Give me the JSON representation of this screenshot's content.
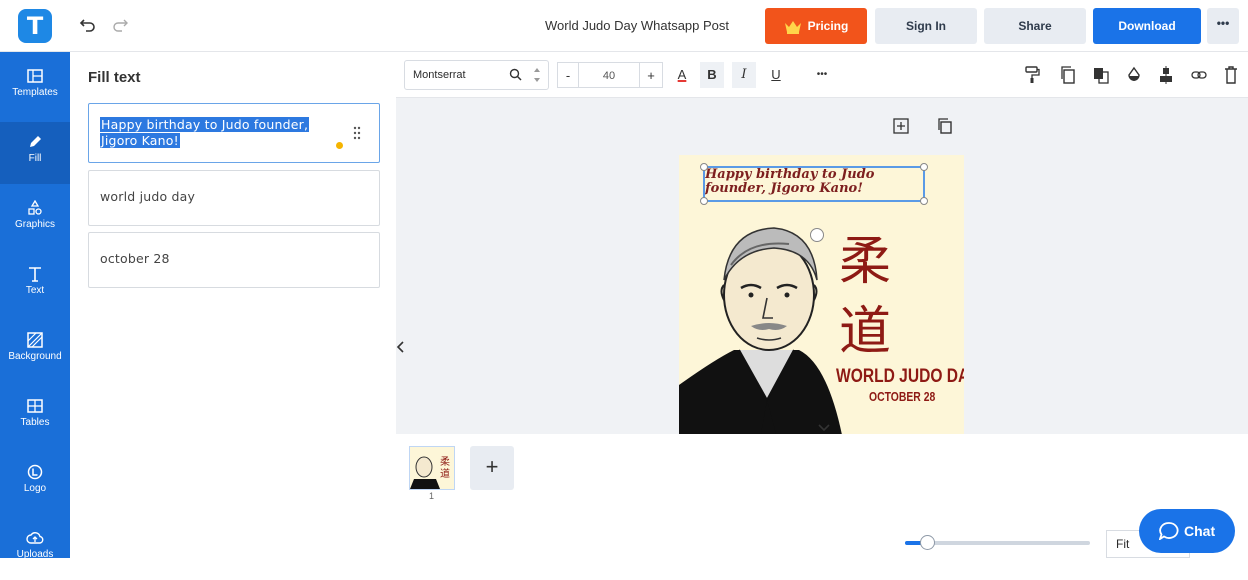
{
  "app": {
    "logo_letter": "T",
    "document_title": "World Judo Day Whatsapp Post"
  },
  "topbar": {
    "pricing_label": "Pricing",
    "signin_label": "Sign In",
    "share_label": "Share",
    "download_label": "Download",
    "more_label": "•••",
    "icons": [
      "undo-icon",
      "redo-icon",
      "crown-icon"
    ]
  },
  "sidebar": {
    "items": [
      {
        "label": "Templates",
        "icon": "templates-icon"
      },
      {
        "label": "Fill",
        "icon": "pencil-icon",
        "active": true
      },
      {
        "label": "Graphics",
        "icon": "shapes-icon"
      },
      {
        "label": "Text",
        "icon": "text-icon"
      },
      {
        "label": "Background",
        "icon": "background-icon"
      },
      {
        "label": "Tables",
        "icon": "table-icon"
      },
      {
        "label": "Logo",
        "icon": "logo-icon"
      },
      {
        "label": "Uploads",
        "icon": "upload-cloud-icon"
      }
    ]
  },
  "fill_panel": {
    "title": "Fill text",
    "fields": [
      {
        "line1": "Happy birthday to Judo founder,",
        "line2": "Jigoro Kano!"
      },
      {
        "line1": "world judo day"
      },
      {
        "line1": "october 28"
      }
    ]
  },
  "toolbar": {
    "font_family": "Montserrat",
    "font_size": "40",
    "decrease_label": "-",
    "increase_label": "+",
    "bold_label": "B",
    "italic_label": "I",
    "underline_label": "U",
    "color_label": "A",
    "more_label": "•••"
  },
  "poster": {
    "headline": "Happy birthday to Judo founder, Jigoro Kano!",
    "kanji": [
      "柔",
      "道"
    ],
    "title": "WORLD JUDO DAY",
    "date": "OCTOBER 28",
    "colors": {
      "background": "#fdf6d8",
      "accent": "#8e1a14"
    }
  },
  "pages": {
    "add_label": "+",
    "page_number": "1"
  },
  "zoom": {
    "fit_label": "Fit",
    "level_fraction": 0.12
  },
  "chat": {
    "label": "Chat"
  },
  "colors": {
    "primary": "#1a73e8",
    "pricing": "#f2541b",
    "sidebar": "#1a6fd8"
  }
}
